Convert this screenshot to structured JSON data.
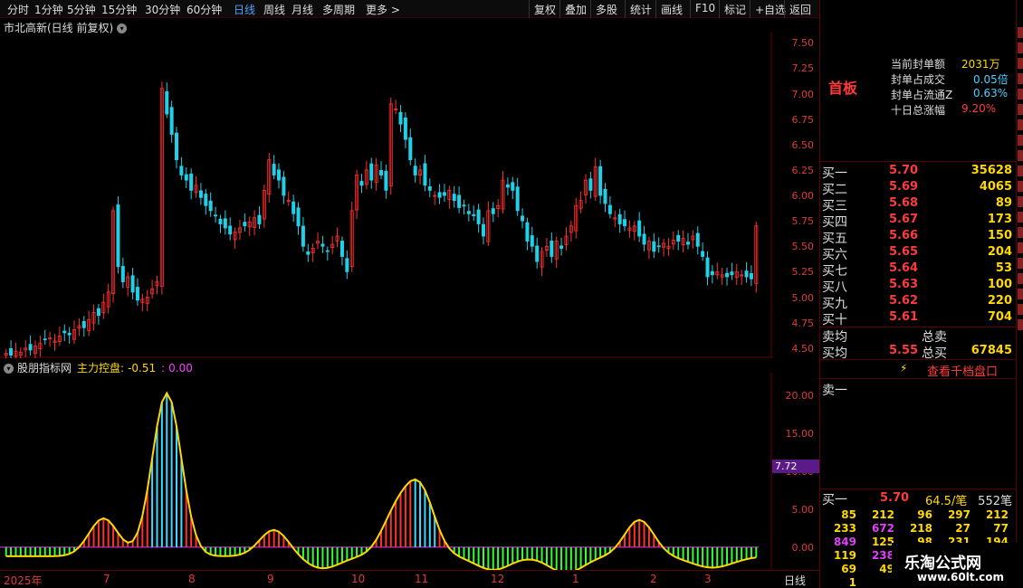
{
  "tabs": [
    "分时",
    "1分钟",
    "5分钟",
    "15分钟",
    "30分钟",
    "60分钟",
    "日线",
    "周线",
    "月线",
    "多周期",
    "更多 >"
  ],
  "active_tab": "日线",
  "right_buttons": [
    "复权",
    "叠加",
    "多股",
    "统计",
    "画线",
    "F10",
    "标记",
    "+自选",
    "返回"
  ],
  "stock_title": "市北高新(日线 前复权)",
  "price_axis": [
    "7.50",
    "7.25",
    "7.00",
    "6.75",
    "6.50",
    "6.25",
    "6.00",
    "5.75",
    "5.50",
    "5.25",
    "5.00",
    "4.75",
    "4.50"
  ],
  "indicator": {
    "name": "股朋指标网",
    "label": "主力控盘:",
    "value1": "-0.51",
    "sep": ":",
    "value2": "0.00"
  },
  "ind_axis": [
    "20.00",
    "15.00",
    "10.00",
    "5.00",
    "0.00"
  ],
  "ind_marker": "7.72",
  "date_axis": [
    "2025年",
    "7",
    "8",
    "9",
    "10",
    "11",
    "12",
    "1",
    "2",
    "3"
  ],
  "period_label": "日线",
  "board_tag": "首板",
  "seal_info": [
    {
      "label": "当前封单额",
      "value": "2031万"
    },
    {
      "label": "封单占成交",
      "value": "0.05倍"
    },
    {
      "label": "封单占流通Z",
      "value": "0.63%"
    },
    {
      "label": "十日总涨幅",
      "value": "9.20%"
    }
  ],
  "bids": [
    {
      "label": "买一",
      "price": "5.70",
      "vol": "35628"
    },
    {
      "label": "买二",
      "price": "5.69",
      "vol": "4065"
    },
    {
      "label": "买三",
      "price": "5.68",
      "vol": "89"
    },
    {
      "label": "买四",
      "price": "5.67",
      "vol": "173"
    },
    {
      "label": "买五",
      "price": "5.66",
      "vol": "150"
    },
    {
      "label": "买六",
      "price": "5.65",
      "vol": "204"
    },
    {
      "label": "买七",
      "price": "5.64",
      "vol": "53"
    },
    {
      "label": "买八",
      "price": "5.63",
      "vol": "100"
    },
    {
      "label": "买九",
      "price": "5.62",
      "vol": "220"
    },
    {
      "label": "买十",
      "price": "5.61",
      "vol": "704"
    }
  ],
  "sell_avg_label": "卖均",
  "total_sell_label": "总卖",
  "buy_avg_label": "买均",
  "buy_avg": "5.55",
  "total_buy_label": "总买",
  "total_buy": "67845",
  "view_depth_button": "查看千档盘口",
  "sell1_label": "卖一",
  "buy1_row": {
    "label": "买一",
    "price": "5.70",
    "per": "64.5/笔",
    "count": "552笔"
  },
  "queue": [
    [
      "85",
      "212",
      "96",
      "297",
      "212"
    ],
    [
      "233",
      "672",
      "218",
      "27",
      "77"
    ],
    [
      "849",
      "125",
      "98",
      "231",
      "194"
    ],
    [
      "119",
      "238",
      "",
      "",
      ""
    ],
    [
      "69",
      "49",
      "",
      "",
      ""
    ],
    [
      "1",
      "",
      "",
      "",
      ""
    ]
  ],
  "watermark": {
    "line1": "乐淘公式网",
    "line2": "www.60lt.com"
  },
  "colors": {
    "up": "#ff3030",
    "down": "#20d0e8",
    "accent": "#ff3a3a",
    "purple": "#e040fb",
    "yellow": "#ffd800",
    "green": "#33ff33",
    "blue_active": "#4aa3ff"
  },
  "chart_data": [
    {
      "type": "candlestick",
      "title": "市北高新(日线 前复权)",
      "ylim": [
        4.4,
        7.6
      ],
      "closes": [
        4.45,
        4.43,
        4.47,
        4.46,
        4.5,
        4.48,
        4.52,
        4.55,
        4.58,
        4.6,
        4.57,
        4.62,
        4.65,
        4.63,
        4.68,
        4.72,
        4.7,
        4.78,
        4.85,
        4.82,
        4.95,
        5.05,
        5.85,
        5.3,
        5.15,
        5.2,
        5.05,
        4.97,
        4.98,
        5.0,
        5.08,
        5.15,
        7.05,
        6.8,
        6.6,
        6.35,
        6.2,
        6.15,
        6.05,
        6.1,
        5.98,
        5.9,
        5.85,
        5.8,
        5.72,
        5.68,
        5.62,
        5.64,
        5.68,
        5.7,
        5.74,
        5.78,
        5.72,
        6.05,
        6.35,
        6.2,
        6.15,
        6.0,
        5.95,
        5.82,
        5.7,
        5.5,
        5.42,
        5.48,
        5.55,
        5.5,
        5.45,
        5.52,
        5.6,
        5.4,
        5.25,
        5.85,
        6.2,
        6.1,
        6.25,
        6.15,
        6.3,
        6.2,
        6.05,
        6.9,
        6.85,
        6.7,
        6.55,
        6.35,
        6.2,
        6.25,
        6.1,
        6.05,
        6.0,
        5.98,
        6.0,
        6.05,
        5.95,
        5.88,
        5.9,
        5.82,
        5.8,
        5.72,
        5.6,
        5.85,
        5.82,
        5.9,
        6.15,
        6.08,
        6.05,
        5.85,
        5.75,
        5.55,
        5.5,
        5.35,
        5.45,
        5.5,
        5.4,
        5.55,
        5.48,
        5.6,
        5.7,
        5.9,
        5.95,
        6.15,
        6.05,
        6.28,
        6.0,
        5.92,
        5.82,
        5.78,
        5.72,
        5.7,
        5.68,
        5.7,
        5.6,
        5.52,
        5.55,
        5.45,
        5.5,
        5.53,
        5.5,
        5.56,
        5.55,
        5.58,
        5.52,
        5.6,
        5.5,
        5.4,
        5.2,
        5.22,
        5.25,
        5.22,
        5.2,
        5.22,
        5.25,
        5.22,
        5.2,
        5.18,
        5.7
      ],
      "grid": false
    },
    {
      "type": "bar",
      "title": "股朋指标网",
      "series": [
        {
          "name": "主力控盘",
          "values": [
            -0.51
          ]
        }
      ],
      "ylim": [
        -3,
        23
      ]
    }
  ]
}
